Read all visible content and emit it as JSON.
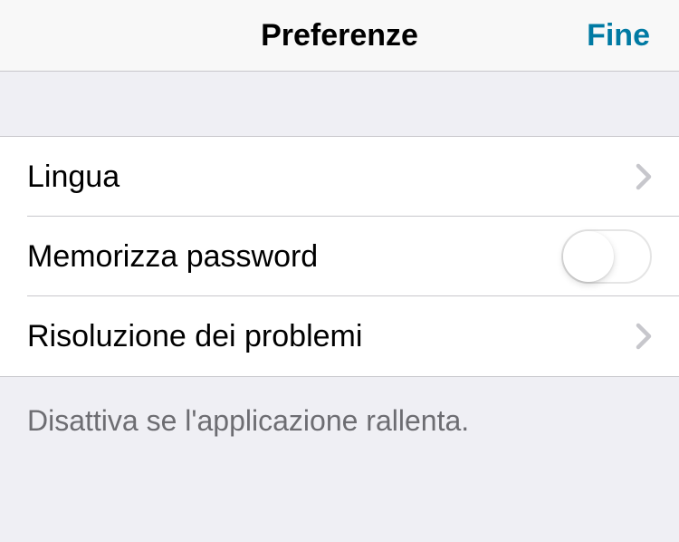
{
  "header": {
    "title": "Preferenze",
    "done_label": "Fine"
  },
  "settings": {
    "language": {
      "label": "Lingua"
    },
    "remember_password": {
      "label": "Memorizza password",
      "enabled": false
    },
    "troubleshooting": {
      "label": "Risoluzione dei problemi"
    }
  },
  "footer": {
    "hint": "Disattiva se l'applicazione rallenta."
  }
}
